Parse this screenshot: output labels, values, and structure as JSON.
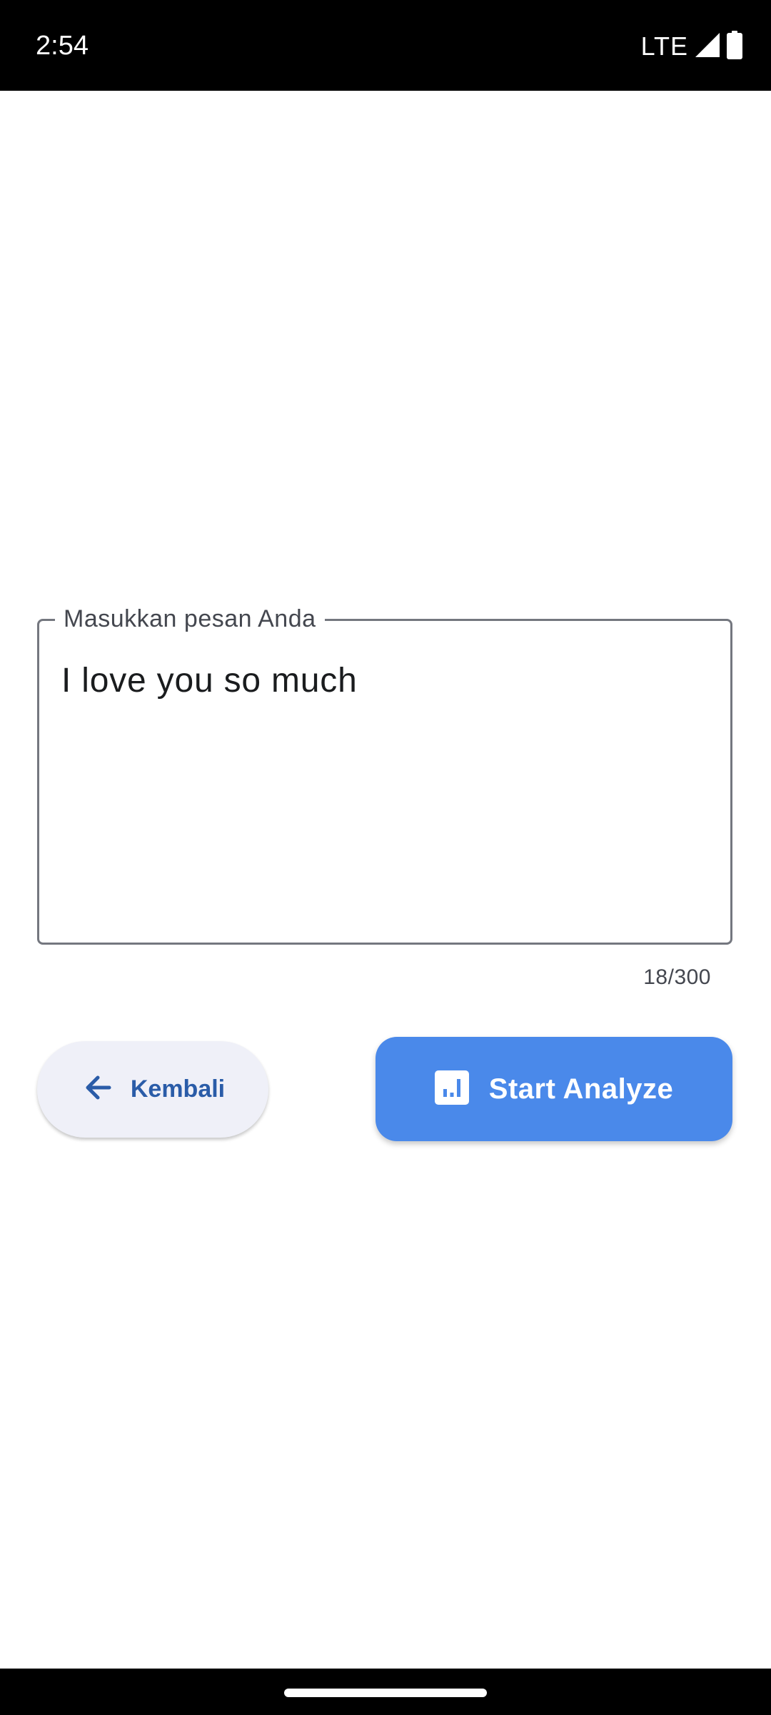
{
  "status_bar": {
    "time": "2:54",
    "network": "LTE",
    "icons": [
      "signal-icon",
      "battery-icon"
    ]
  },
  "message_field": {
    "label": "Masukkan pesan Anda",
    "value": "I love you so much",
    "counter": "18/300"
  },
  "actions": {
    "back": {
      "label": "Kembali",
      "icon": "arrow-left-icon"
    },
    "analyze": {
      "label": "Start Analyze",
      "icon": "bar-chart-icon"
    }
  },
  "colors": {
    "primary": "#4a89ea",
    "back_bg": "#eff0f8",
    "back_text": "#2a5ca8",
    "outline": "#74777f"
  }
}
